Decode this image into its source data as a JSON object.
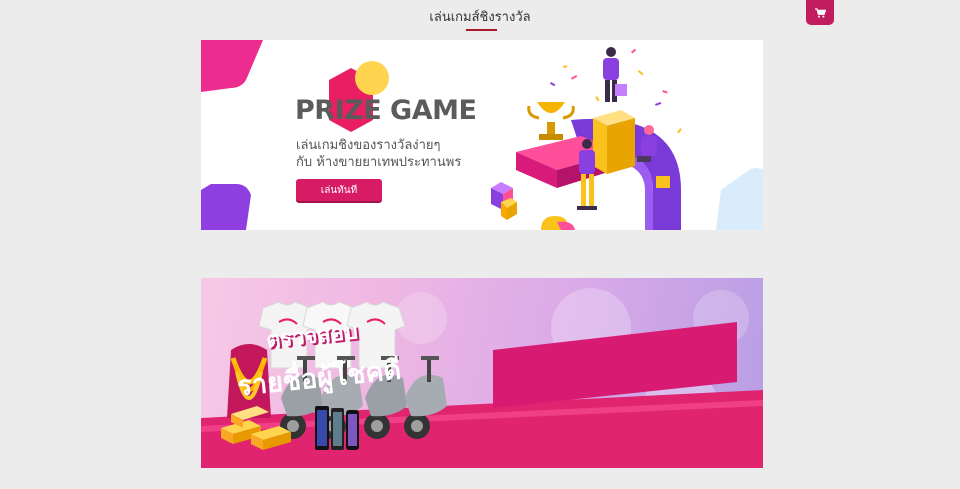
{
  "header": {
    "title": "เล่นเกมส์ชิงรางวัล",
    "cart_icon": "shopping-cart-icon"
  },
  "prize_banner": {
    "heading": "PRIZE GAME",
    "line1": "เล่นเกมชิงของรางวัลง่ายๆ",
    "line2": "กับ ห้างขายยาเทพประทานพร",
    "play_button": "เล่นทันที"
  },
  "winners_banner": {
    "line1": "ตรวจสอบ",
    "line2": "รายชื่อผู้โชคดี"
  },
  "colors": {
    "accent": "#d81b65",
    "title_underline": "#a8192e",
    "cart": "#c01c5f"
  }
}
